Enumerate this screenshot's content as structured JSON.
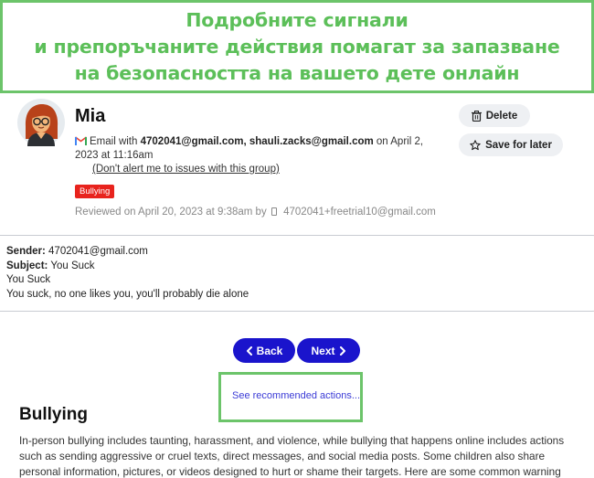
{
  "banner": {
    "line1": "Подробните сигнали",
    "line2": "и препоръчаните действия помагат за запазване",
    "line3": "на безопасността на вашето дете онлайн"
  },
  "alert": {
    "name": "Mia",
    "email_prefix": "Email with ",
    "email_addresses": "4702041@gmail.com, shauli.zacks@gmail.com",
    "email_date": " on April 2, 2023 at 11:16am",
    "dont_alert": "(Don't alert me to issues with this group)",
    "badge": "Bullying",
    "reviewed": "Reviewed on April 20, 2023 at 9:38am by",
    "reviewer": "4702041+freetrial10@gmail.com"
  },
  "actions": {
    "delete_label": "Delete",
    "save_label": "Save for later"
  },
  "message": {
    "sender_label": "Sender:",
    "sender_value": " 4702041@gmail.com",
    "subject_label": "Subject:",
    "subject_value": " You Suck",
    "body_line1": "You Suck",
    "body_line2": "You suck, no one likes you, you'll probably die alone"
  },
  "nav": {
    "back_label": "Back",
    "next_label": "Next"
  },
  "recommended_link": "See recommended actions...",
  "section": {
    "title": "Bullying",
    "text": "In-person bullying includes taunting, harassment, and violence, while bullying that happens online includes actions such as sending aggressive or cruel texts, direct messages, and social media posts. Some children also share personal information, pictures, or videos designed to hurt or shame their targets. Here are some common warning signs that your"
  },
  "colors": {
    "banner_green": "#5cbf59",
    "badge_red": "#e8231d",
    "nav_blue": "#1a14cc",
    "link_blue": "#3a3ad6"
  }
}
